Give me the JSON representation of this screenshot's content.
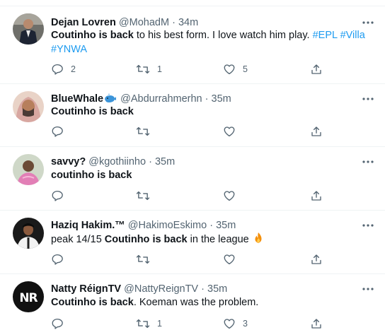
{
  "tweets": [
    {
      "name": "Dejan Lovren",
      "handle": "@MohadM",
      "dot": "·",
      "time": "34m",
      "line1": [
        {
          "text": "Coutinho is back",
          "style": "bold"
        },
        {
          "text": " to his best form. I love watch him play. ",
          "style": "plain"
        },
        {
          "text": "#EPL",
          "style": "tag"
        },
        {
          "text": " ",
          "style": "plain"
        },
        {
          "text": "#Villa",
          "style": "tag"
        }
      ],
      "line2": [
        {
          "text": "#YNWA",
          "style": "tag"
        }
      ],
      "replies": "2",
      "retweets": "1",
      "likes": "5"
    },
    {
      "name": "BlueWhale",
      "name_emoji": "whale-emoji",
      "handle": "@Abdurrahmerhn",
      "dot": "·",
      "time": "35m",
      "line1": [
        {
          "text": "Coutinho is back",
          "style": "bold"
        }
      ],
      "replies": "",
      "retweets": "",
      "likes": ""
    },
    {
      "name": "savvy?",
      "handle": "@kgothiinho",
      "dot": "·",
      "time": "35m",
      "line1": [
        {
          "text": "coutinho is back",
          "style": "bold"
        }
      ],
      "replies": "",
      "retweets": "",
      "likes": ""
    },
    {
      "name": "Haziq Hakim.™",
      "handle": "@HakimoEskimo",
      "dot": "·",
      "time": "35m",
      "line1": [
        {
          "text": "peak 14/15 ",
          "style": "plain"
        },
        {
          "text": "Coutinho is back",
          "style": "bold"
        },
        {
          "text": " in the league",
          "style": "plain"
        }
      ],
      "text_emoji": "fire-emoji",
      "replies": "",
      "retweets": "",
      "likes": ""
    },
    {
      "name": "Natty RéignTV",
      "handle": "@NattyReignTV",
      "dot": "·",
      "time": "35m",
      "avatar_text": "NR",
      "line1": [
        {
          "text": "Coutinho is back",
          "style": "bold"
        },
        {
          "text": ". Koeman was the problem.",
          "style": "plain"
        }
      ],
      "replies": "",
      "retweets": "1",
      "likes": "3"
    }
  ],
  "colors": {
    "link": "#1d9bf0",
    "muted": "#536471",
    "text": "#0f1419",
    "divider": "#eff3f4"
  }
}
